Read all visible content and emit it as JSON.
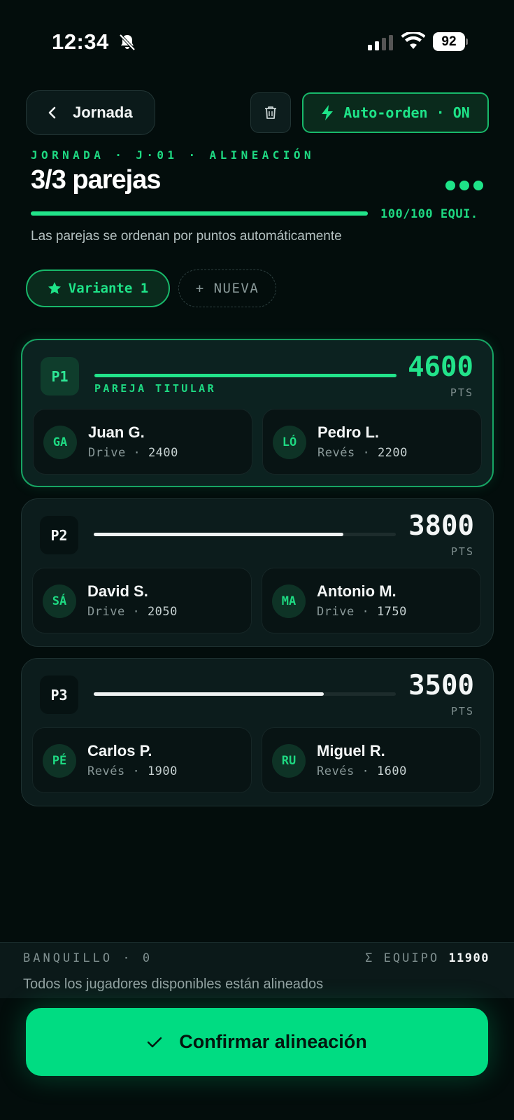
{
  "status_bar": {
    "time": "12:34",
    "battery": "92"
  },
  "header": {
    "back_label": "Jornada",
    "auto_order_label": "Auto-orden · ON",
    "eyebrow": "JORNADA · J·01 · ALINEACIÓN",
    "title": "3/3 parejas",
    "progress": {
      "value": 100,
      "max": 100,
      "label": "100/100 EQUI."
    },
    "subtitle": "Las parejas se ordenan por puntos automáticamente"
  },
  "variants": {
    "active_label": "Variante 1",
    "new_label": "+ NUEVA"
  },
  "pairs": [
    {
      "badge": "P1",
      "tag": "PAREJA TITULAR",
      "points": "4600",
      "points_label": "PTS",
      "bar_fraction": 1.0,
      "players": [
        {
          "initials": "GA",
          "name": "Juan G.",
          "position": "Drive",
          "sep": "·",
          "points": "2400"
        },
        {
          "initials": "LÓ",
          "name": "Pedro L.",
          "position": "Revés",
          "sep": "·",
          "points": "2200"
        }
      ]
    },
    {
      "badge": "P2",
      "tag": "",
      "points": "3800",
      "points_label": "PTS",
      "bar_fraction": 0.826,
      "players": [
        {
          "initials": "SÁ",
          "name": "David S.",
          "position": "Drive",
          "sep": "·",
          "points": "2050"
        },
        {
          "initials": "MA",
          "name": "Antonio M.",
          "position": "Drive",
          "sep": "·",
          "points": "1750"
        }
      ]
    },
    {
      "badge": "P3",
      "tag": "",
      "points": "3500",
      "points_label": "PTS",
      "bar_fraction": 0.761,
      "players": [
        {
          "initials": "PÉ",
          "name": "Carlos P.",
          "position": "Revés",
          "sep": "·",
          "points": "1900"
        },
        {
          "initials": "RU",
          "name": "Miguel R.",
          "position": "Revés",
          "sep": "·",
          "points": "1600"
        }
      ]
    }
  ],
  "bench": {
    "label": "BANQUILLO · 0",
    "team_label": "Σ EQUIPO",
    "team_total": "11900",
    "message": "Todos los jugadores disponibles están alineados"
  },
  "confirm_label": "Confirmar alineación",
  "colors": {
    "accent": "#00dc82",
    "background": "#030d0c",
    "card": "#0c1c1c"
  },
  "icons": [
    "bell-slash-icon",
    "signal-icon",
    "wifi-icon",
    "battery-icon",
    "chevron-left-icon",
    "trash-icon",
    "bolt-icon",
    "star-icon",
    "more-dots-icon",
    "check-icon"
  ]
}
